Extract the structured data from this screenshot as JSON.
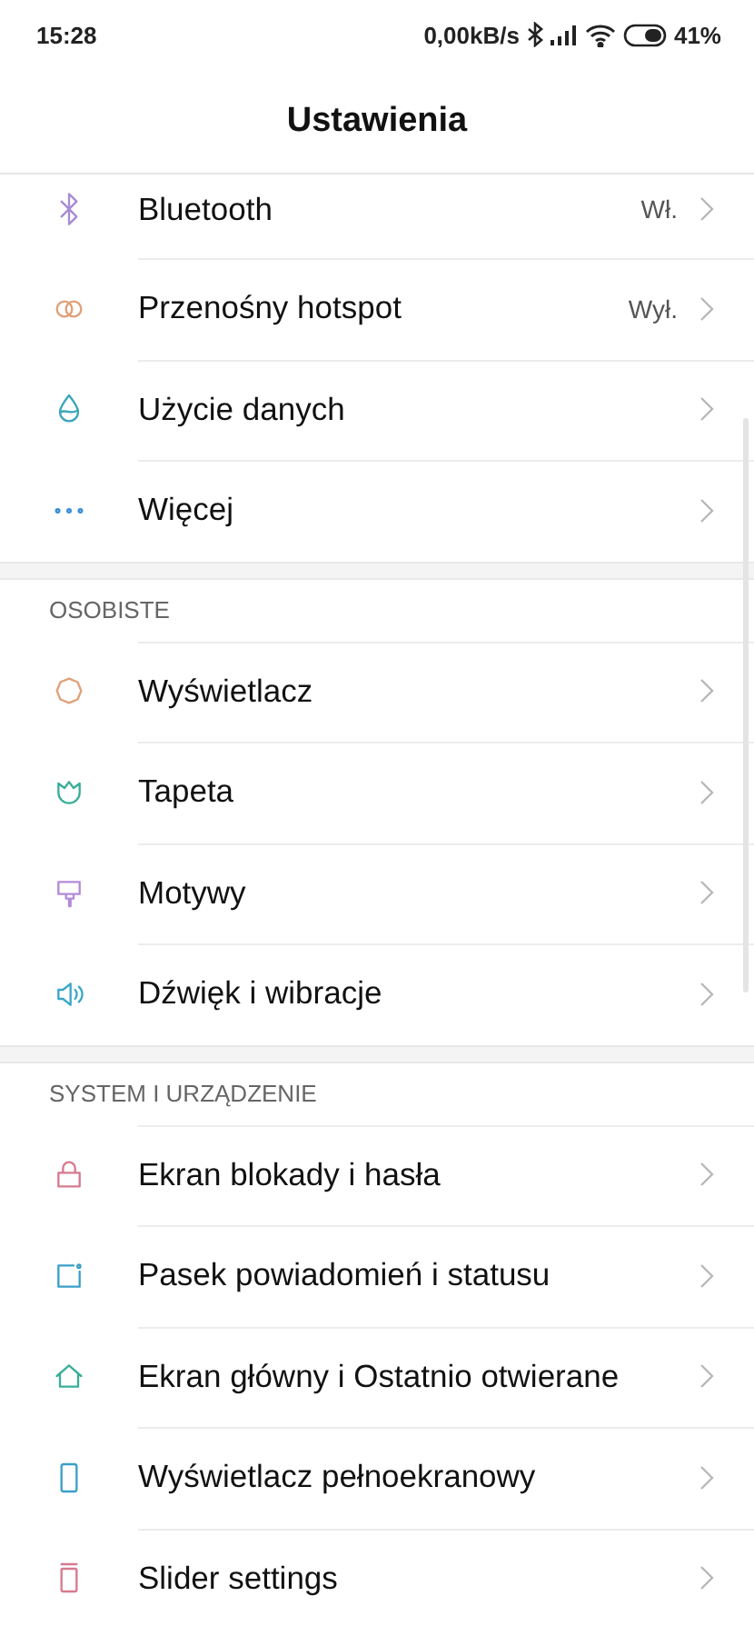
{
  "status_bar": {
    "time": "15:28",
    "network_speed": "0,00kB/s",
    "battery": "41%"
  },
  "title": "Ustawienia",
  "sections": [
    {
      "items": [
        {
          "color": "#a78bd6",
          "label": "Bluetooth",
          "value": "Wł."
        },
        {
          "color": "#e0a078",
          "label": "Przenośny hotspot",
          "value": "Wył."
        },
        {
          "color": "#3aa6b8",
          "label": "Użycie danych"
        },
        {
          "color": "#3a8fd6",
          "label": "Więcej"
        }
      ]
    },
    {
      "header": "OSOBISTE",
      "items": [
        {
          "color": "#e0a078",
          "label": "Wyświetlacz"
        },
        {
          "color": "#3aae9a",
          "label": "Tapeta"
        },
        {
          "color": "#b28ad9",
          "label": "Motywy"
        },
        {
          "color": "#3aa6c8",
          "label": "Dźwięk i wibracje"
        }
      ]
    },
    {
      "header": "SYSTEM I URZĄDZENIE",
      "items": [
        {
          "color": "#d67a8e",
          "label": "Ekran blokady i hasła"
        },
        {
          "color": "#3a9fc8",
          "label": "Pasek powiadomień i statusu"
        },
        {
          "color": "#3aae9a",
          "label": "Ekran główny i Ostatnio otwierane"
        },
        {
          "color": "#3a9fc8",
          "label": "Wyświetlacz pełnoekranowy"
        },
        {
          "color": "#d67a8e",
          "label": "Slider settings"
        }
      ]
    }
  ]
}
